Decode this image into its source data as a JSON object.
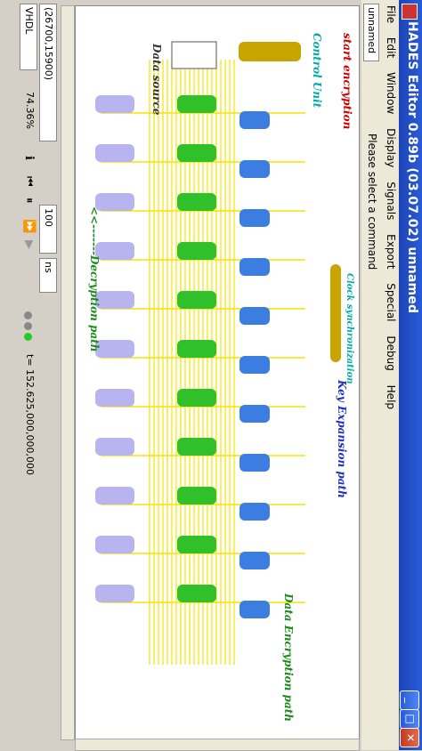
{
  "window": {
    "title": "HADES Editor 0.89b (03.07.02) unnamed",
    "tab_name": "unnamed"
  },
  "menu": [
    "File",
    "Edit",
    "Window",
    "Display",
    "Signals",
    "Export",
    "Special",
    "Debug",
    "Help"
  ],
  "command": {
    "prompt": "Please select a command"
  },
  "schematic": {
    "labels": {
      "start": "start encryption",
      "control": "Control Unit",
      "data_source": "Data source",
      "clock_sync": "Clock synchronization",
      "key_expansion": "Key Expansion path",
      "data_encryption": "Data Encryption path",
      "decryption": "<<-------Decryption path"
    },
    "colors": {
      "wire": "#f5e400",
      "control_unit": "#c8a400",
      "key_block": "#3b7de0",
      "data_block": "#2fc02a",
      "decrypt_block": "#b8b4f0"
    }
  },
  "status": {
    "coords": "(26700,15900)",
    "zoom": "74.36%",
    "language": "VHDL",
    "step_value": "100",
    "step_unit": "ns",
    "sim_time": "t= 152.625,000,000,000"
  }
}
